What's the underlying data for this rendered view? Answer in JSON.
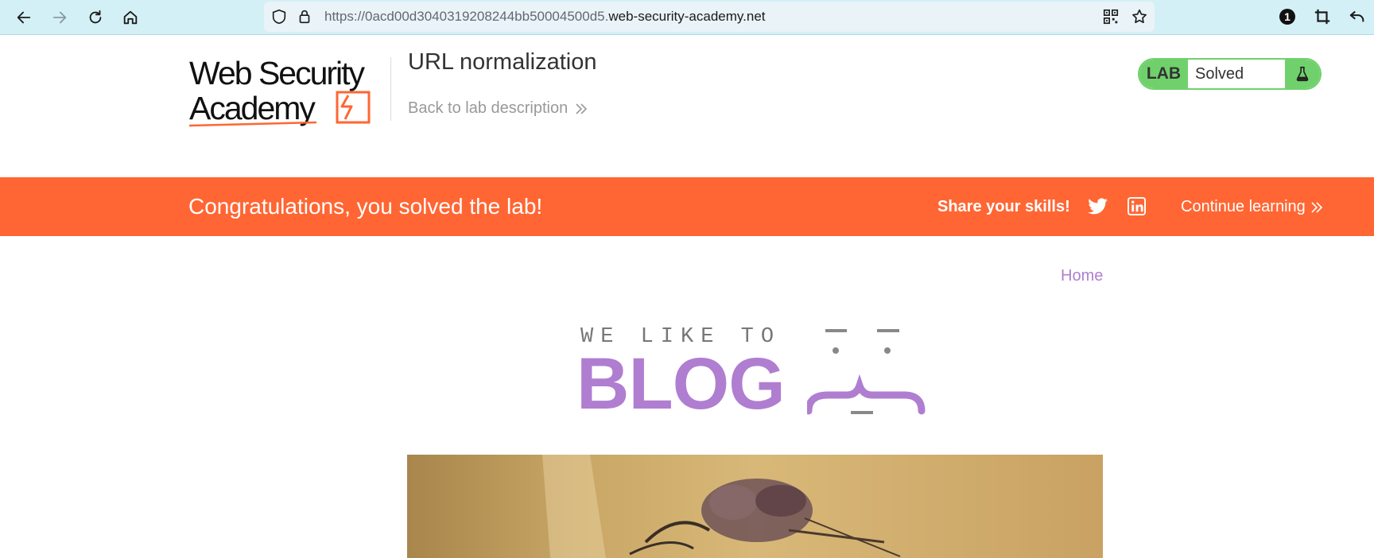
{
  "browser": {
    "url_prefix": "https://0acd00d3040319208244bb50004500d5.",
    "url_host": "web-security-academy.net",
    "extension_badge": "1"
  },
  "header": {
    "logo_line1": "Web Security",
    "logo_line2": "Academy",
    "lab_title": "URL normalization",
    "back_link": "Back to lab description",
    "lab_label": "LAB",
    "lab_status": "Solved"
  },
  "banner": {
    "congrats": "Congratulations, you solved the lab!",
    "share": "Share your skills!",
    "continue": "Continue learning"
  },
  "page": {
    "home_link": "Home",
    "blog_tagline": "WE LIKE TO",
    "blog_word": "BLOG"
  },
  "colors": {
    "banner_orange": "#ff6633",
    "lab_green": "#70d16c",
    "blog_purple": "#b07ed0",
    "chrome_blue": "#d4f0f7"
  }
}
